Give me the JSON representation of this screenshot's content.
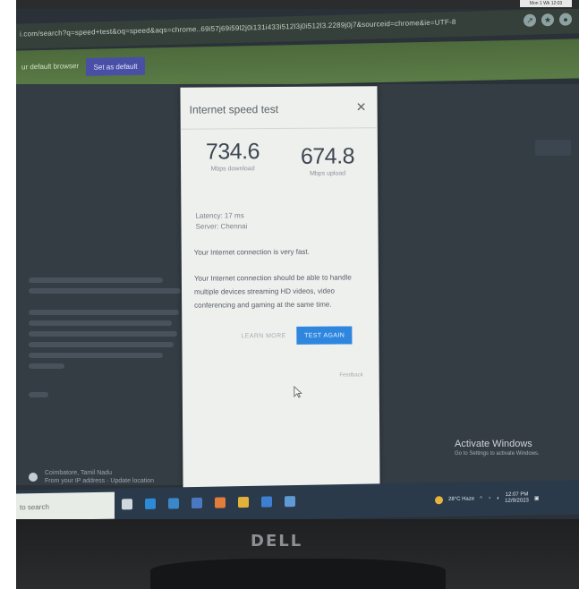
{
  "sticker": {
    "text": "Mon 1 Wk 12:03"
  },
  "browser": {
    "url": "i.com/search?q=speed+test&oq=speed&aqs=chrome..69i57j69i59l2j0i131i433i512l3j0i512l3.2289j0j7&sourceid=chrome&ie=UTF-8",
    "infobar_message": "ur default browser",
    "set_default_label": "Set as default"
  },
  "speed_test": {
    "title": "Internet speed test",
    "close_icon": "close-icon",
    "download": {
      "value": "734.6",
      "label": "Mbps download"
    },
    "upload": {
      "value": "674.8",
      "label": "Mbps upload"
    },
    "latency": "Latency: 17 ms",
    "server": "Server: Chennai",
    "summary": "Your Internet connection is very fast.",
    "description": "Your Internet connection should be able to handle multiple devices streaming HD videos, video conferencing and gaming at the same time.",
    "learn_more_label": "LEARN MORE",
    "test_again_label": "TEST AGAIN",
    "feedback_label": "Feedback"
  },
  "background_page": {
    "chip_line1": "Coimbatore, Tamil Nadu",
    "chip_line2": "From your IP address · Update location"
  },
  "windows": {
    "activate_title": "Activate Windows",
    "activate_subtitle": "Go to Settings to activate Windows.",
    "search_placeholder": "to search",
    "weather": "28°C Haze",
    "time": "12:07 PM",
    "date": "12/9/2023"
  },
  "monitor": {
    "brand": "DELL"
  },
  "colors": {
    "accent": "#2f86de",
    "infobar": "#5b7c47",
    "set_default_button": "#4a4fa6"
  }
}
